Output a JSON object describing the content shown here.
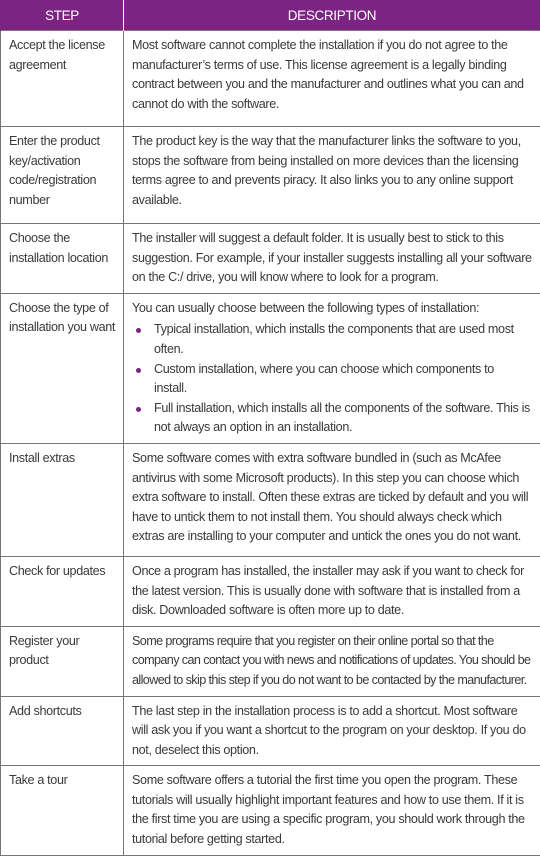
{
  "header": {
    "step": "STEP",
    "description": "DESCRIPTION"
  },
  "colors": {
    "header_bg": "#7b2481",
    "bullet": "#7b2481",
    "border": "#777777",
    "text": "#3a3a3a"
  },
  "rows": [
    {
      "step": "Accept the license agreement",
      "description": "Most software cannot complete the installation if you do not agree to the manufacturer’s terms of use. This license agreement is a legally binding contract between you and the manufacturer and outlines what you can and cannot do with the software."
    },
    {
      "step": "Enter the product key/activation code/registration number",
      "description": "The product key is the way that the manufacturer links the software to you, stops the software from being installed on more devices than the licensing terms agree to and prevents piracy. It also links you to any online support available."
    },
    {
      "step": "Choose the installation location",
      "description": "The installer will suggest a default folder. It is usually best to stick to this suggestion. For example, if your installer suggests installing all your software on the C:/ drive, you will know where to look for a program."
    },
    {
      "step": "Choose the type of installation you want",
      "description": "You can usually choose between the following types of installation:",
      "bullets": [
        "Typical installation, which installs the components that are used most often.",
        "Custom installation, where you can choose which components to install.",
        "Full installation, which installs all the components of the software. This is not always an option in an installation."
      ]
    },
    {
      "step": "Install extras",
      "description": "Some software comes with extra software bundled in (such as McAfee antivirus with some Microsoft products). In this step you can choose which extra software to install. Often these extras are ticked by default and you will have to untick them to not install them. You should always check which extras are installing to your computer and untick the ones you do not want."
    },
    {
      "step": "Check for updates",
      "description": "Once a program has installed, the installer may ask if you want to check for the latest version. This is usually done with software that is installed from a disk. Downloaded software is often more up to date."
    },
    {
      "step": "Register your product",
      "description": "Some programs require that you register on their online portal so that the company can contact you with news and notifications of updates. You should be allowed to skip this step if you do not want to be contacted by the manufacturer."
    },
    {
      "step": "Add shortcuts",
      "description": "The last step in the installation process is to add a shortcut. Most software will ask you if you want a shortcut to the program on your desktop. If you do not, deselect this option."
    },
    {
      "step": "Take a tour",
      "description": "Some software offers a tutorial the first time you open the program. These tutorials will usually highlight important features and how to use them. If it is the first time you are using a specific program, you should work through the tutorial before getting started."
    }
  ]
}
